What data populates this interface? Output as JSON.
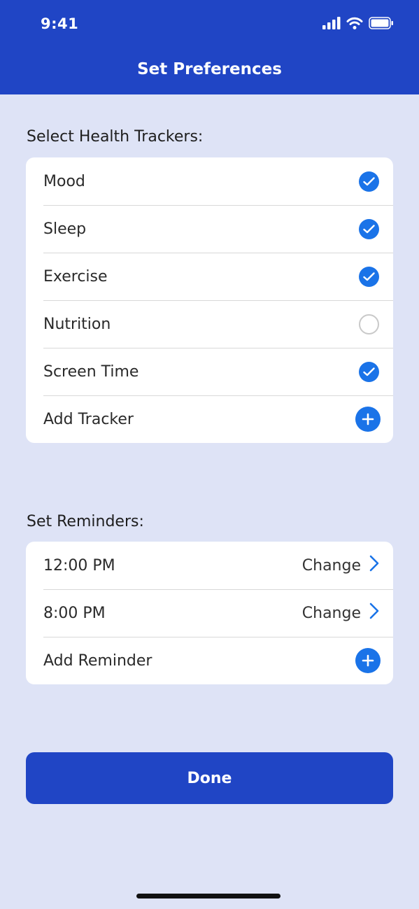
{
  "status_bar": {
    "time": "9:41",
    "icons": [
      "signal-icon",
      "wifi-icon",
      "battery-icon"
    ]
  },
  "header": {
    "title": "Set Preferences",
    "background": "#2045c5"
  },
  "trackers": {
    "title": "Select Health Trackers:",
    "items": [
      {
        "label": "Mood",
        "selected": true
      },
      {
        "label": "Sleep",
        "selected": true
      },
      {
        "label": "Exercise",
        "selected": true
      },
      {
        "label": "Nutrition",
        "selected": false
      },
      {
        "label": "Screen Time",
        "selected": true
      }
    ],
    "add_label": "Add Tracker"
  },
  "reminders": {
    "title": "Set Reminders:",
    "items": [
      {
        "time": "12:00 PM",
        "action": "Change"
      },
      {
        "time": "8:00 PM",
        "action": "Change"
      }
    ],
    "add_label": "Add Reminder"
  },
  "done_label": "Done",
  "colors": {
    "accent": "#1a73e8",
    "primary": "#2045c5",
    "background": "#dee3f6"
  }
}
